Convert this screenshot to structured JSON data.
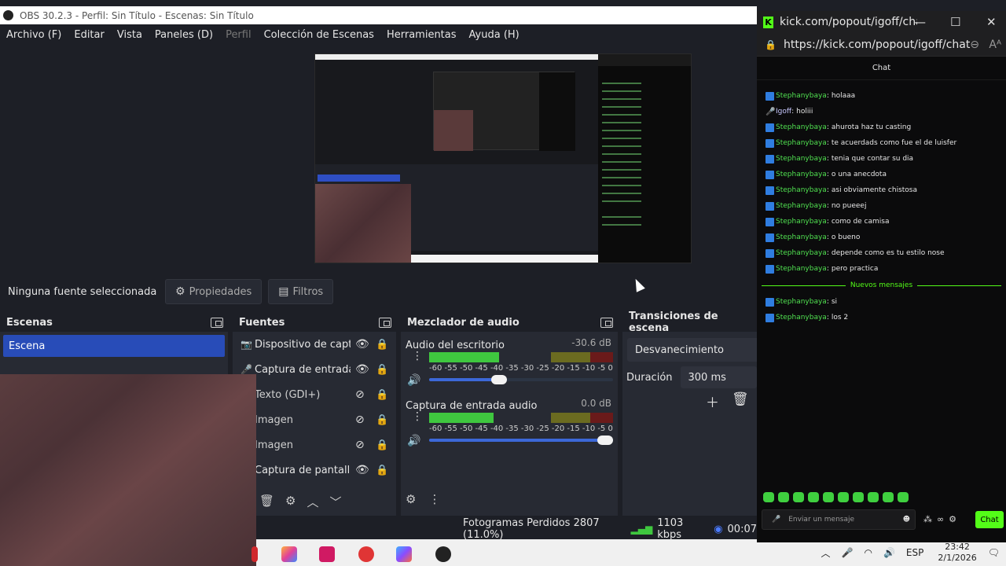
{
  "obs": {
    "title": "OBS 30.2.3 - Perfil: Sin Título - Escenas: Sin Título",
    "menu": [
      "Archivo (F)",
      "Editar",
      "Vista",
      "Paneles (D)",
      "Perfil",
      "Colección de Escenas",
      "Herramientas",
      "Ayuda (H)"
    ],
    "no_selection": "Ninguna fuente seleccionada",
    "properties_label": "Propiedades",
    "filters_label": "Filtros",
    "scenes": {
      "title": "Escenas",
      "items": [
        "Escena"
      ]
    },
    "sources": {
      "title": "Fuentes",
      "items": [
        {
          "label": "Dispositivo de captura de video",
          "icon": "camera-icon",
          "visible": true
        },
        {
          "label": "Captura de entrada audio",
          "icon": "mic-icon",
          "visible": true
        },
        {
          "label": "Texto (GDI+)",
          "icon": "text-icon",
          "visible": false
        },
        {
          "label": "Imagen",
          "icon": "image-icon",
          "visible": false
        },
        {
          "label": "Imagen",
          "icon": "image-icon",
          "visible": false
        },
        {
          "label": "Captura de pantalla",
          "icon": "monitor-icon",
          "visible": true
        }
      ]
    },
    "mixer": {
      "title": "Mezclador de audio",
      "channels": [
        {
          "name": "Audio del escritorio",
          "db": "-30.6 dB",
          "level": 0.38,
          "volume": 0.37
        },
        {
          "name": "Captura de entrada audio",
          "db": "0.0 dB",
          "level": 0.35,
          "volume": 1.0
        }
      ],
      "scale": [
        "-60",
        "-55",
        "-50",
        "-45",
        "-40",
        "-35",
        "-30",
        "-25",
        "-20",
        "-15",
        "-10",
        "-5",
        "0"
      ]
    },
    "transitions": {
      "title": "Transiciones de escena",
      "selected": "Desvanecimiento",
      "duration_label": "Duración",
      "duration_value": "300 ms"
    },
    "status": {
      "frames": "Fotogramas Perdidos 2807 (11.0%)",
      "kbps": "1103 kbps",
      "time": "00:07"
    }
  },
  "kick": {
    "window_title": "kick.com/popout/igoff/chat",
    "url": "https://kick.com/popout/igoff/chat",
    "chat_header": "Chat",
    "messages": [
      {
        "user": "Stephanybaya",
        "text": "holaaa",
        "badge": "stream"
      },
      {
        "user": "Igoff",
        "text": "holiii",
        "badge": "mic"
      },
      {
        "user": "Stephanybaya",
        "text": "ahurota haz tu casting",
        "badge": "stream"
      },
      {
        "user": "Stephanybaya",
        "text": "te acuerdads como fue el de luisfer",
        "badge": "stream"
      },
      {
        "user": "Stephanybaya",
        "text": "tenia que contar su dia",
        "badge": "stream"
      },
      {
        "user": "Stephanybaya",
        "text": "o una anecdota",
        "badge": "stream"
      },
      {
        "user": "Stephanybaya",
        "text": "asi obviamente chistosa",
        "badge": "stream"
      },
      {
        "user": "Stephanybaya",
        "text": "no pueeej",
        "badge": "stream"
      },
      {
        "user": "Stephanybaya",
        "text": "como de camisa",
        "badge": "stream"
      },
      {
        "user": "Stephanybaya",
        "text": "o bueno",
        "badge": "stream"
      },
      {
        "user": "Stephanybaya",
        "text": "depende como es tu estilo nose",
        "badge": "stream"
      },
      {
        "user": "Stephanybaya",
        "text": "pero practica",
        "badge": "stream"
      }
    ],
    "new_messages_label": "Nuevos mensajes",
    "new_messages": [
      {
        "user": "Stephanybaya",
        "text": "si",
        "badge": "stream"
      },
      {
        "user": "Stephanybaya",
        "text": "los 2",
        "badge": "stream"
      }
    ],
    "input_placeholder": "Enviar un mensaje",
    "chat_button": "Chat",
    "accent": "#53fc18"
  },
  "taskbar": {
    "lang": "ESP",
    "time": "23:42",
    "date": "2/1/2026"
  }
}
